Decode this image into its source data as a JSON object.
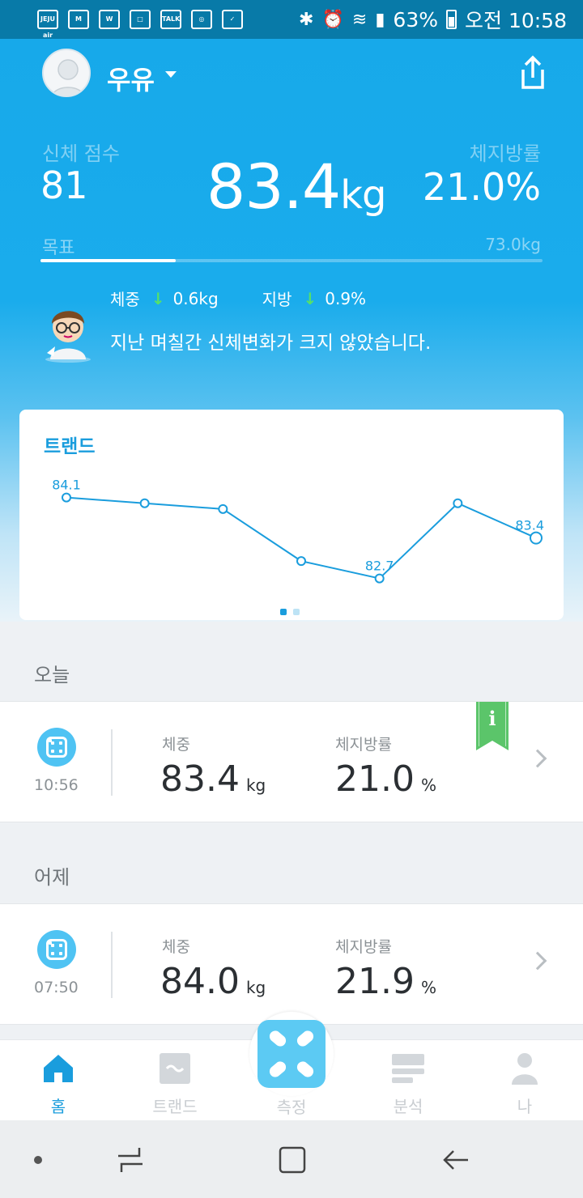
{
  "status_bar": {
    "app_icons": [
      "JEJU air",
      "M",
      "W",
      "□",
      "TALK",
      "◎",
      "✓"
    ],
    "battery": "63%",
    "time": "오전 10:58"
  },
  "header": {
    "user_name": "우유",
    "body_score_label": "신체 점수",
    "body_score": "81",
    "weight_value": "83.4",
    "weight_unit": "kg",
    "body_fat_label": "체지방률",
    "body_fat": "21.0%",
    "goal_label": "목표",
    "goal_value": "73.0kg",
    "goal_progress": 0.27
  },
  "change": {
    "weight_label": "체중",
    "weight_arrow": "↓",
    "weight_delta": "0.6kg",
    "fat_label": "지방",
    "fat_arrow": "↓",
    "fat_delta": "0.9%",
    "message": "지난 며칠간 신체변화가 크지 않았습니다."
  },
  "trend": {
    "title": "트랜드",
    "page_count": 2,
    "active_page": 0
  },
  "chart_data": {
    "type": "line",
    "title": "트랜드",
    "values": [
      84.1,
      84.0,
      83.9,
      83.0,
      82.7,
      84.0,
      83.4
    ],
    "labels": [
      "84.1",
      "",
      "",
      "",
      "82.7",
      "",
      "83.4"
    ],
    "ylim": [
      82.4,
      84.5
    ],
    "color": "#1a9ddd"
  },
  "sections": [
    {
      "title": "오늘",
      "time": "10:56",
      "weight_label": "체중",
      "weight": "83.4",
      "weight_unit": "kg",
      "fat_label": "체지방률",
      "fat": "21.0",
      "fat_unit": "%",
      "badge": "i"
    },
    {
      "title": "어제",
      "time": "07:50",
      "weight_label": "체중",
      "weight": "84.0",
      "weight_unit": "kg",
      "fat_label": "체지방률",
      "fat": "21.9",
      "fat_unit": "%"
    }
  ],
  "bottom_nav": {
    "home": "홈",
    "trend": "트랜드",
    "measure": "측정",
    "analysis": "분석",
    "me": "나"
  },
  "colors": {
    "accent": "#1a9ddd",
    "header_top": "#17a9ea",
    "status_bar": "#087aa8",
    "down_arrow": "#55e06a",
    "badge": "#5bc56a"
  }
}
